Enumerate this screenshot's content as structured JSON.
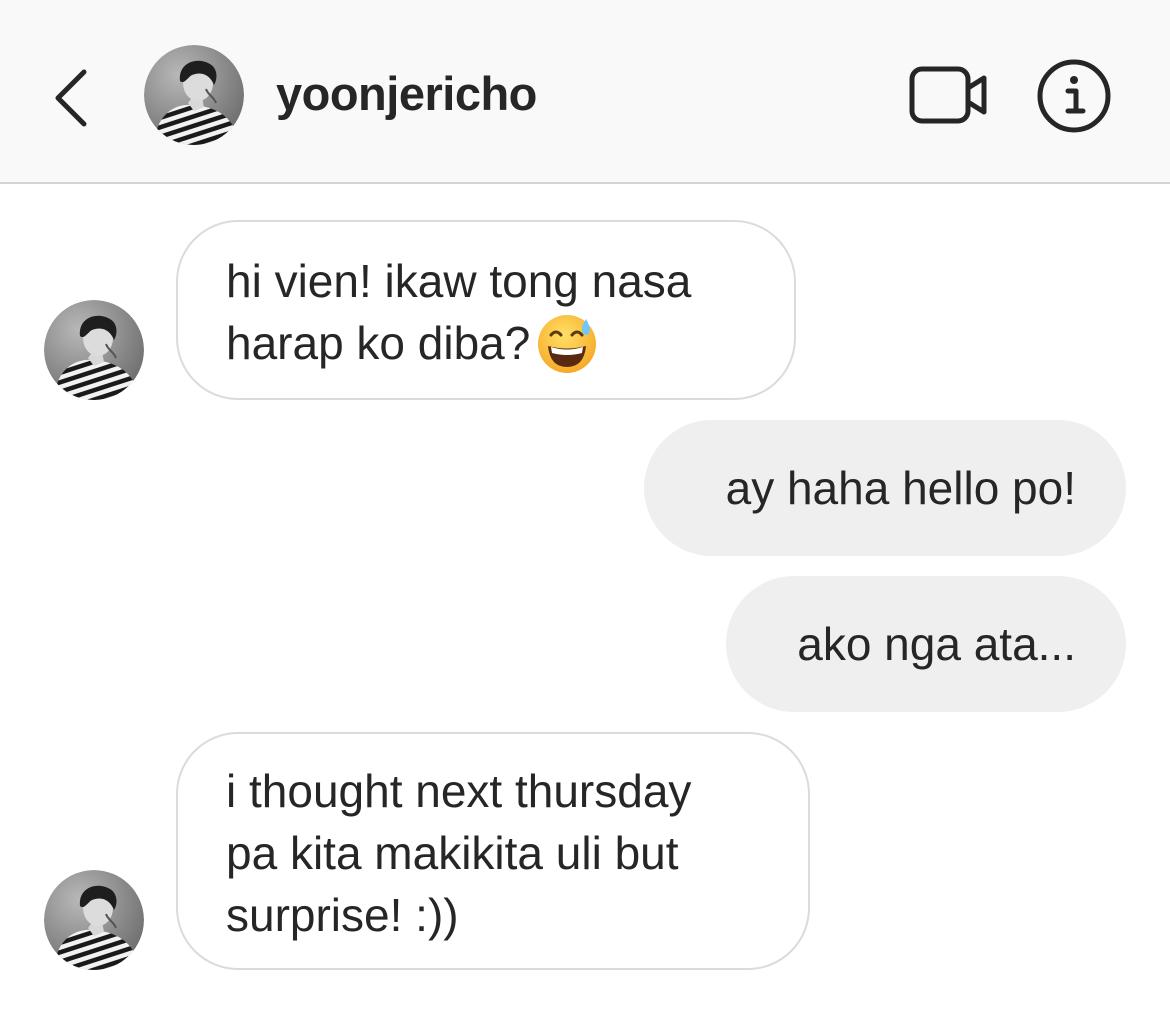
{
  "header": {
    "back_icon": "chevron-left-icon",
    "username": "yoonjericho",
    "video_icon": "video-camera-icon",
    "info_icon": "info-icon"
  },
  "messages": [
    {
      "direction": "incoming",
      "lines": [
        "hi vien! ikaw tong nasa",
        "harap ko diba?"
      ],
      "emoji": "grinning-sweat-emoji"
    },
    {
      "direction": "outgoing",
      "lines": [
        "ay haha hello po!"
      ]
    },
    {
      "direction": "outgoing",
      "lines": [
        "ako nga ata..."
      ]
    },
    {
      "direction": "incoming",
      "lines": [
        "i thought next thursday",
        "pa kita makikita uli but",
        "surprise! :))"
      ]
    }
  ],
  "colors": {
    "header_bg": "#f9f9f9",
    "incoming_border": "#dbdbdb",
    "outgoing_bg": "#efefef",
    "text": "#262626"
  }
}
